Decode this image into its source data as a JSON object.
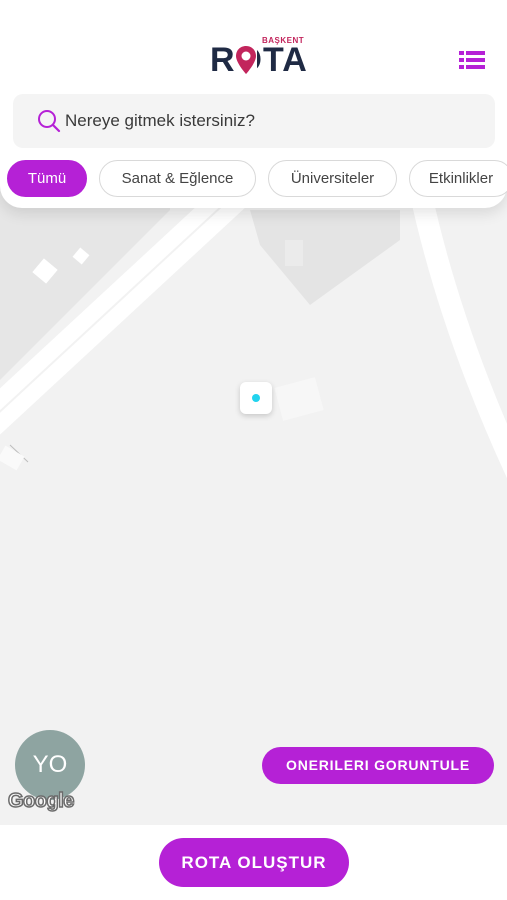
{
  "header": {
    "logo_small": "BAŞKENT",
    "logo_main": "ROTA"
  },
  "search": {
    "placeholder": "Nereye gitmek istersiniz?"
  },
  "filters": [
    {
      "label": "Tümü",
      "active": true
    },
    {
      "label": "Sanat & Eğlence",
      "active": false
    },
    {
      "label": "Üniversiteler",
      "active": false
    },
    {
      "label": "Etkinlikler",
      "active": false
    }
  ],
  "map": {
    "user_initials": "YO",
    "attribution": "Google"
  },
  "actions": {
    "suggestions_label": "ONERILERI GORUNTULE",
    "create_route_label": "ROTA OLUŞTUR"
  },
  "colors": {
    "accent": "#b521d6",
    "logo_dark": "#1f2a44",
    "logo_red": "#c2255c",
    "location_dot": "#22d3ee",
    "avatar": "#8ea4a1"
  },
  "icons": {
    "search": "search-icon",
    "menu": "list-menu-icon",
    "pin": "map-pin-icon"
  }
}
